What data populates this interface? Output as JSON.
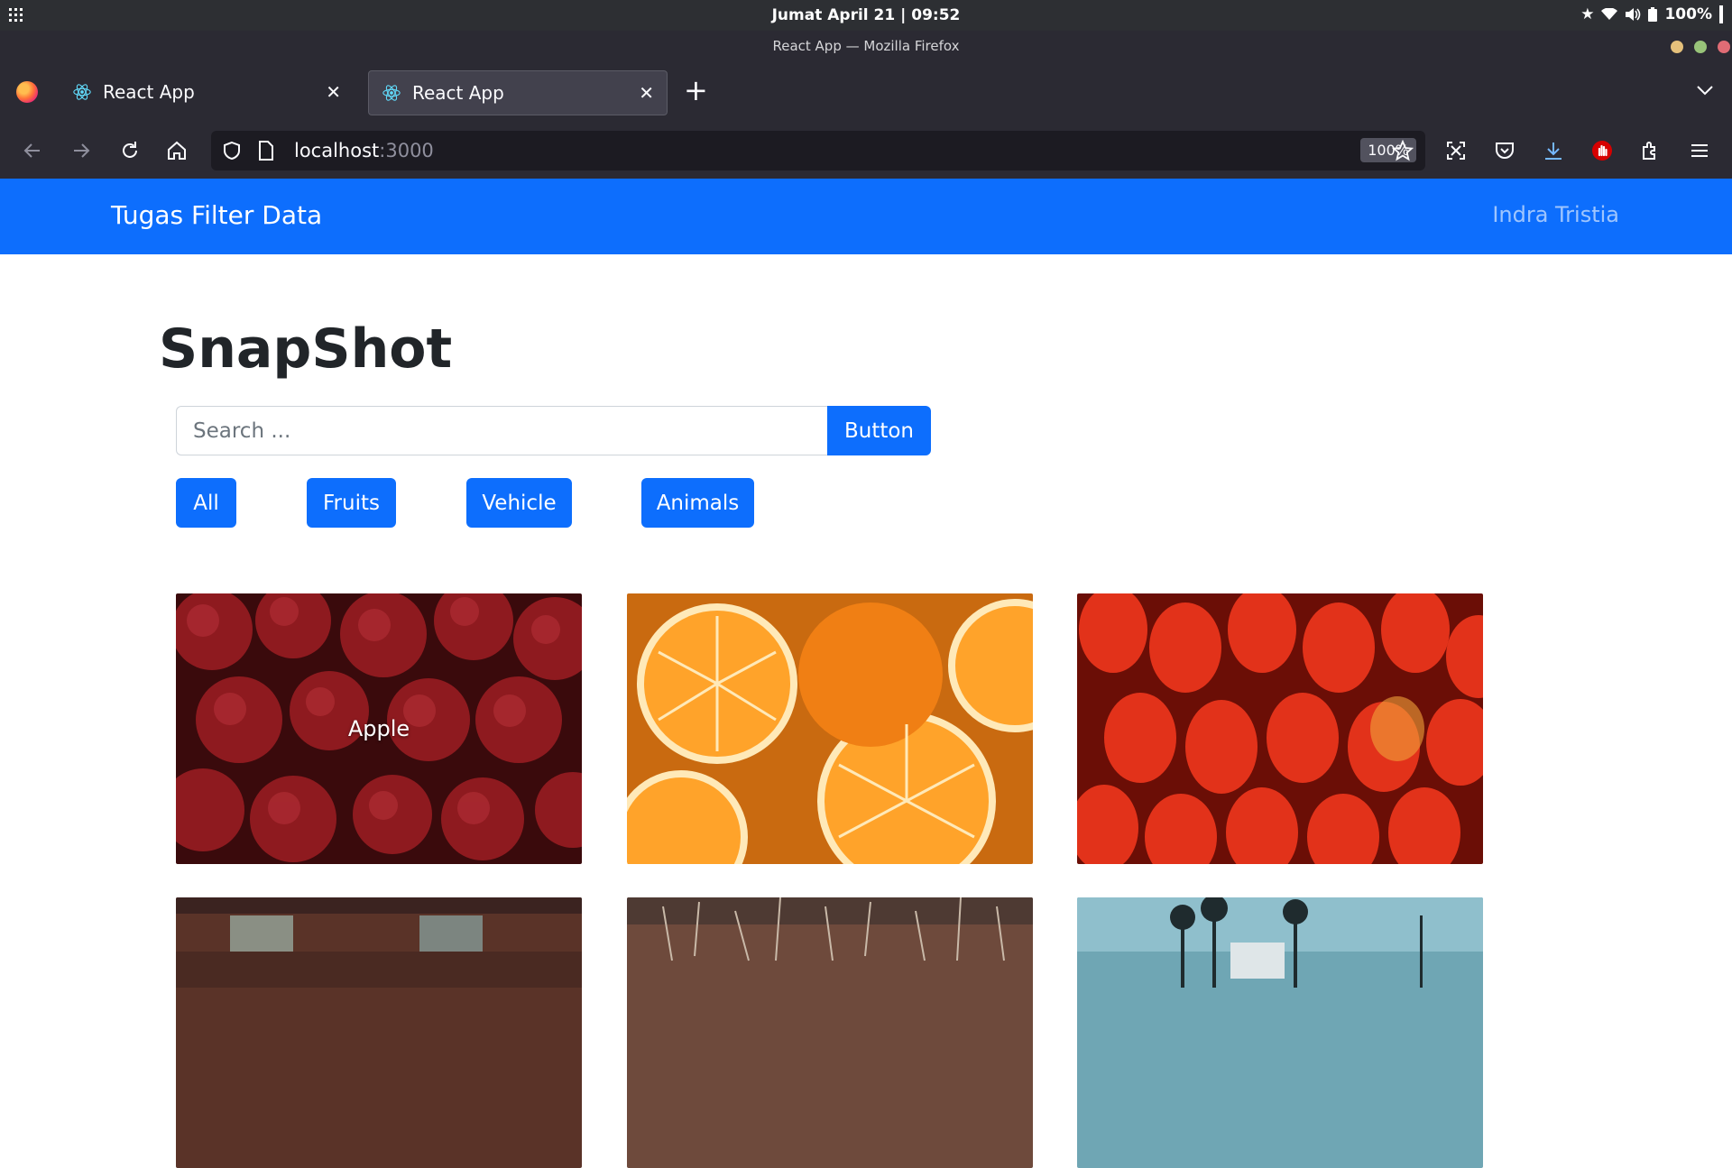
{
  "system_bar": {
    "clock": "Jumat April 21 | 09:52",
    "battery": "100%"
  },
  "window": {
    "title": "React App — Mozilla Firefox"
  },
  "tabs": [
    {
      "label": "React App",
      "active": false
    },
    {
      "label": "React App",
      "active": true
    }
  ],
  "address_bar": {
    "host": "localhost",
    "port": ":3000",
    "zoom": "100%"
  },
  "app": {
    "brand": "Tugas Filter Data",
    "user": "Indra Tristia",
    "heading": "SnapShot",
    "search": {
      "placeholder": "Search ...",
      "button_label": "Button"
    },
    "filters": [
      "All",
      "Fruits",
      "Vehicle",
      "Animals"
    ],
    "gallery": [
      {
        "image": "apples",
        "caption": "Apple"
      },
      {
        "image": "oranges",
        "caption": ""
      },
      {
        "image": "strawberries",
        "caption": ""
      },
      {
        "image": "motorcycle-street",
        "caption": ""
      },
      {
        "image": "animal-dry-grass",
        "caption": ""
      },
      {
        "image": "palm-street",
        "caption": ""
      }
    ]
  },
  "colors": {
    "primary": "#0d6efd",
    "browser_chrome": "#2b2a33",
    "system_bar": "#2d2f33"
  }
}
